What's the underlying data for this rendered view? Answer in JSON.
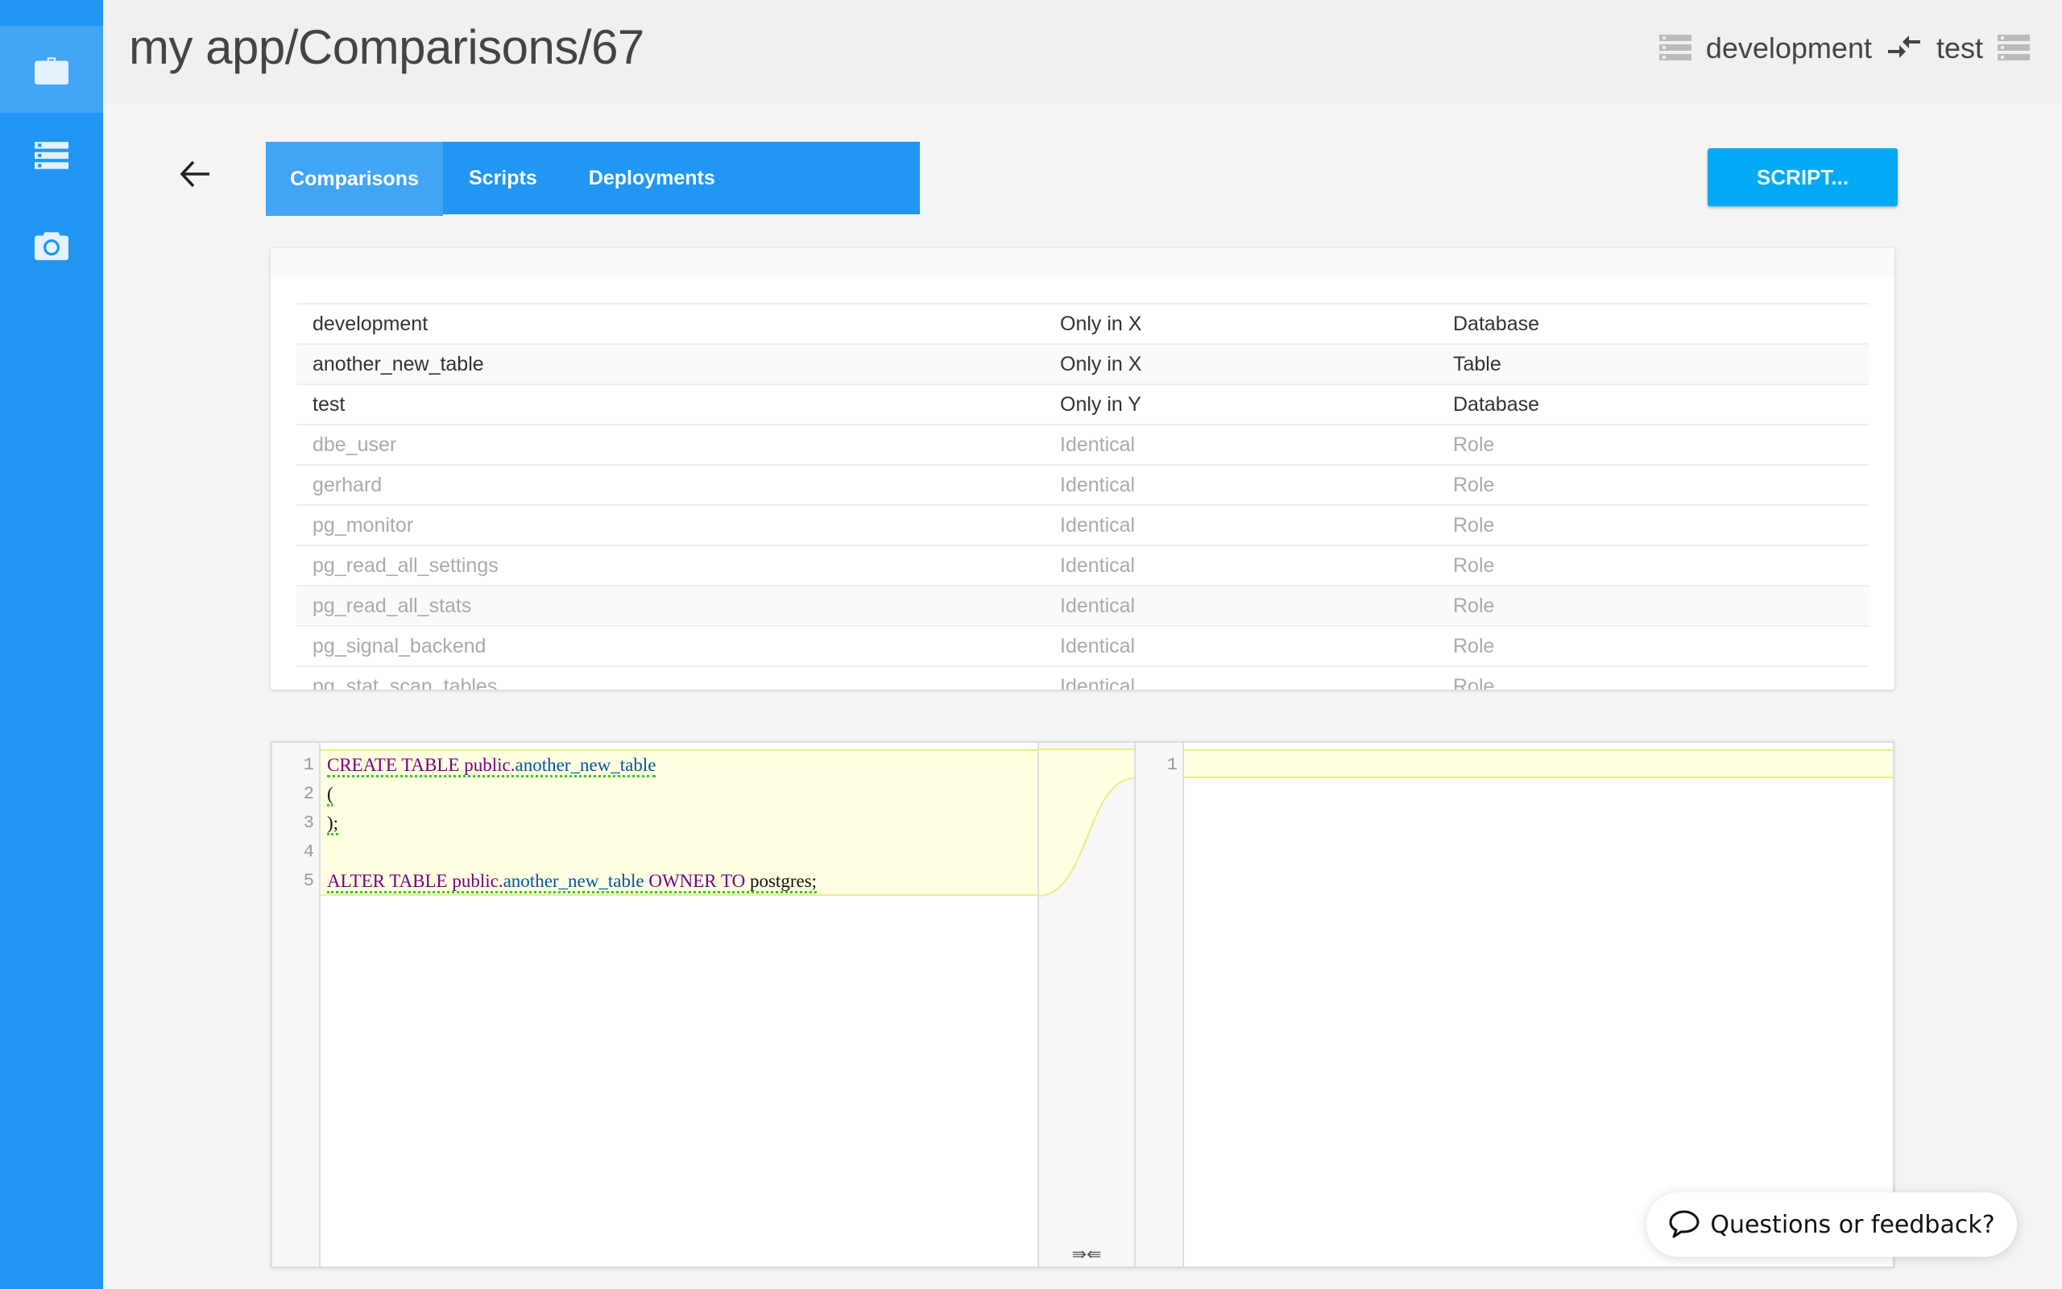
{
  "header": {
    "title": "my app/Comparisons/67",
    "source_env": "development",
    "target_env": "test",
    "source_icon": "database-icon",
    "compare_icon": "compare-arrows-icon",
    "target_icon": "database-icon"
  },
  "sidebar": {
    "items": [
      {
        "icon": "briefcase-icon",
        "active": true
      },
      {
        "icon": "database-list-icon",
        "active": false
      },
      {
        "icon": "camera-icon",
        "active": false
      }
    ]
  },
  "nav": {
    "back_icon": "arrow-back-icon",
    "tabs": [
      {
        "label": "Comparisons",
        "active": true
      },
      {
        "label": "Scripts",
        "active": false
      },
      {
        "label": "Deployments",
        "active": false
      }
    ],
    "script_button": "SCRIPT..."
  },
  "comparison_table": {
    "rows": [
      {
        "name": "development",
        "status": "Only in X",
        "type": "Database"
      },
      {
        "name": "another_new_table",
        "status": "Only in X",
        "type": "Table"
      },
      {
        "name": "test",
        "status": "Only in Y",
        "type": "Database"
      },
      {
        "name": "dbe_user",
        "status": "Identical",
        "type": "Role"
      },
      {
        "name": "gerhard",
        "status": "Identical",
        "type": "Role"
      },
      {
        "name": "pg_monitor",
        "status": "Identical",
        "type": "Role"
      },
      {
        "name": "pg_read_all_settings",
        "status": "Identical",
        "type": "Role"
      },
      {
        "name": "pg_read_all_stats",
        "status": "Identical",
        "type": "Role"
      },
      {
        "name": "pg_signal_backend",
        "status": "Identical",
        "type": "Role"
      },
      {
        "name": "pg_stat_scan_tables",
        "status": "Identical",
        "type": "Role"
      }
    ]
  },
  "diff_editor": {
    "left": {
      "line_numbers": [
        "1",
        "2",
        "3",
        "4",
        "5"
      ],
      "lines": [
        [
          {
            "t": "CREATE TABLE ",
            "c": "kw"
          },
          {
            "t": "public.",
            "c": "kw"
          },
          {
            "t": "another_new_table",
            "c": "id"
          }
        ],
        [
          {
            "t": "(",
            "c": "plain"
          }
        ],
        [
          {
            "t": ");",
            "c": "plain"
          }
        ],
        [],
        [
          {
            "t": "ALTER TABLE ",
            "c": "kw"
          },
          {
            "t": "public.",
            "c": "kw"
          },
          {
            "t": "another_new_table",
            "c": "id"
          },
          {
            "t": " OWNER TO ",
            "c": "kw"
          },
          {
            "t": "postgres;",
            "c": "plain"
          }
        ]
      ]
    },
    "right": {
      "line_numbers": [
        "1"
      ],
      "lines": [
        []
      ]
    },
    "merge_icon": "⇛⇚"
  },
  "feedback": {
    "label": "Questions or feedback?",
    "icon": "chat-bubble-icon"
  }
}
